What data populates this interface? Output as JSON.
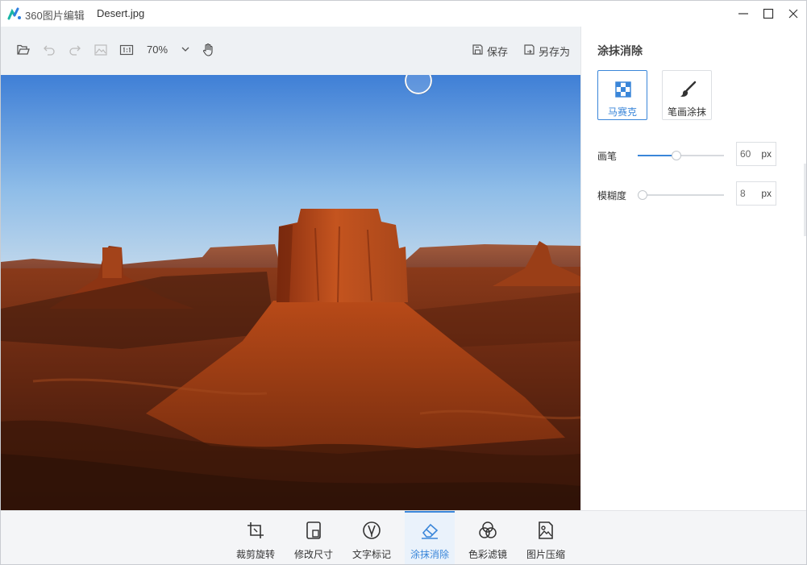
{
  "window": {
    "app_name": "360图片编辑",
    "file_name": "Desert.jpg",
    "controls": [
      "minimize-icon",
      "maximize-icon",
      "close-icon"
    ]
  },
  "toolbar": {
    "icons": [
      "folder-open-icon",
      "undo-icon",
      "redo-icon",
      "image-icon",
      "actual-size-icon"
    ],
    "zoom": "70%",
    "save_label": "保存",
    "save_as_label": "另存为"
  },
  "canvas": {
    "image": "desert-buttes-photo",
    "brush_cursor": "circle-brush-cursor"
  },
  "panel": {
    "title": "涂抹消除",
    "modes": [
      {
        "label": "马赛克",
        "icon": "mosaic-icon",
        "active": true
      },
      {
        "label": "笔画涂抹",
        "icon": "brush-icon",
        "active": false
      }
    ],
    "brush": {
      "label": "画笔",
      "value": "60",
      "unit": "px",
      "level": 0.45
    },
    "blur": {
      "label": "模糊度",
      "value": "8",
      "unit": "px",
      "level": 0.0
    }
  },
  "bottom_tools": [
    {
      "label": "裁剪旋转",
      "icon": "crop-rotate-icon",
      "active": false
    },
    {
      "label": "修改尺寸",
      "icon": "resize-icon",
      "active": false
    },
    {
      "label": "文字标记",
      "icon": "text-mark-icon",
      "active": false
    },
    {
      "label": "涂抹消除",
      "icon": "eraser-icon",
      "active": true
    },
    {
      "label": "色彩滤镜",
      "icon": "color-filter-icon",
      "active": false
    },
    {
      "label": "图片压缩",
      "icon": "compress-image-icon",
      "active": false
    }
  ],
  "colors": {
    "accent": "#3a86d9",
    "toolbar_bg": "#eef1f4",
    "bottombar_bg": "#f4f5f7"
  }
}
